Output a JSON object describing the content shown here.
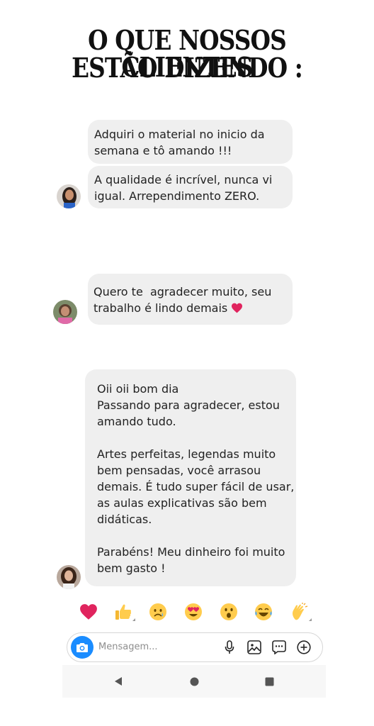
{
  "header": {
    "title_line1": "O QUE NOSSOS CLIENTES",
    "title_line2": "ESTÃO DIZENDO :"
  },
  "messages": [
    {
      "text": "Adquiri o material no inicio da\nsemana e tô amando !!!"
    },
    {
      "text": "A qualidade é incrível, nunca vi\nigual. Arrependimento ZERO."
    },
    {
      "text": "Quero te  agradecer muito, seu\ntrabalho é lindo demais",
      "emoji": "❤️"
    },
    {
      "text": "Oii oii bom dia\nPassando para agradecer, estou\namando tudo.\n\nArtes perfeitas, legendas muito\nbem pensadas, você arrasou\ndemais. É tudo super fácil de usar,\nas aulas explicativas são bem\ndidáticas.\n\nParabéns! Meu dinheiro foi muito\nbem gasto !"
    }
  ],
  "reactions": [
    "heart-icon",
    "thumbs-up-icon",
    "crying-face-icon",
    "heart-eyes-icon",
    "surprised-face-icon",
    "laughing-tears-icon",
    "clapping-hands-icon"
  ],
  "composer": {
    "placeholder": "Mensagem..."
  },
  "colors": {
    "bubble": "#efefef",
    "camera": "#1a8cff",
    "heart": "#e0245e"
  }
}
